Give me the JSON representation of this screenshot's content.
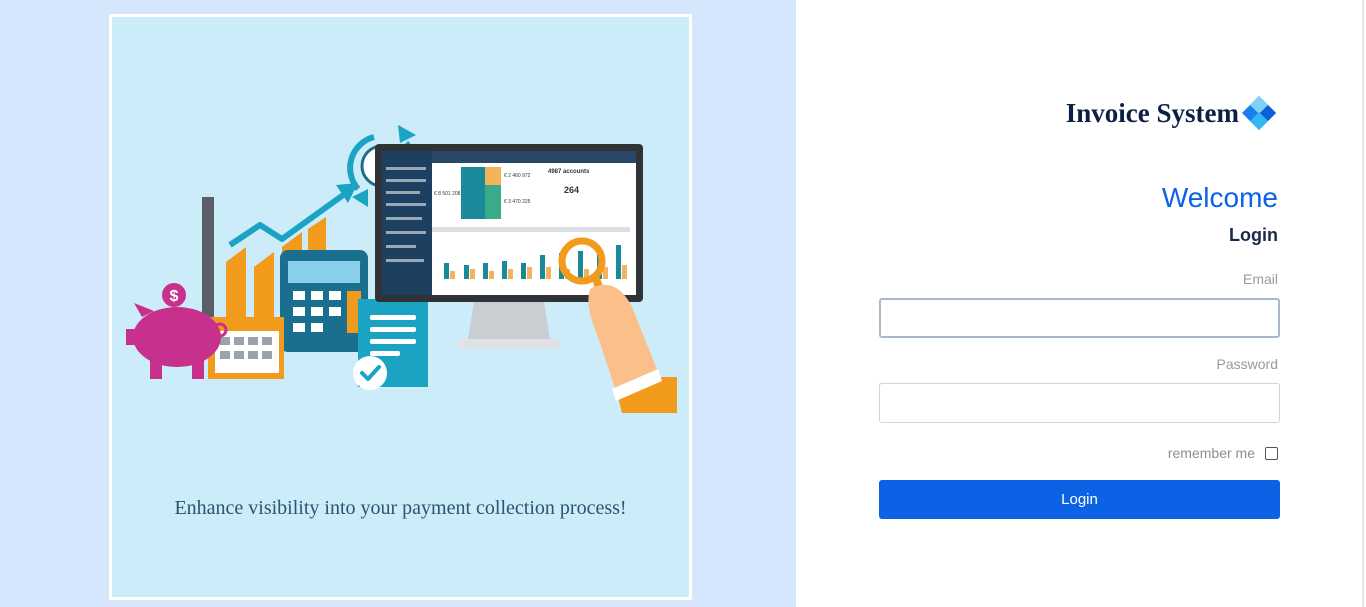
{
  "illustration": {
    "tagline": "Enhance visibility into your payment collection process!",
    "dashboard_text": {
      "value_a": "€ 2 460 972",
      "value_b": "€ 3 470 225",
      "value_c": "€ 8 501 208",
      "accounts": "4987 accounts",
      "count": "264"
    }
  },
  "brand": {
    "name": "Invoice System",
    "logo_icon": "diamond-logo-icon"
  },
  "form": {
    "welcome": "Welcome",
    "heading": "Login",
    "email_label": "Email",
    "email_value": "",
    "password_label": "Password",
    "password_value": "",
    "remember_label": "remember me",
    "remember_checked": false,
    "submit_label": "Login"
  },
  "colors": {
    "accent": "#0b62e4",
    "left_background": "#d5e6fd",
    "illustration_background": "#ccecf9",
    "brand_text": "#0e1f45"
  }
}
